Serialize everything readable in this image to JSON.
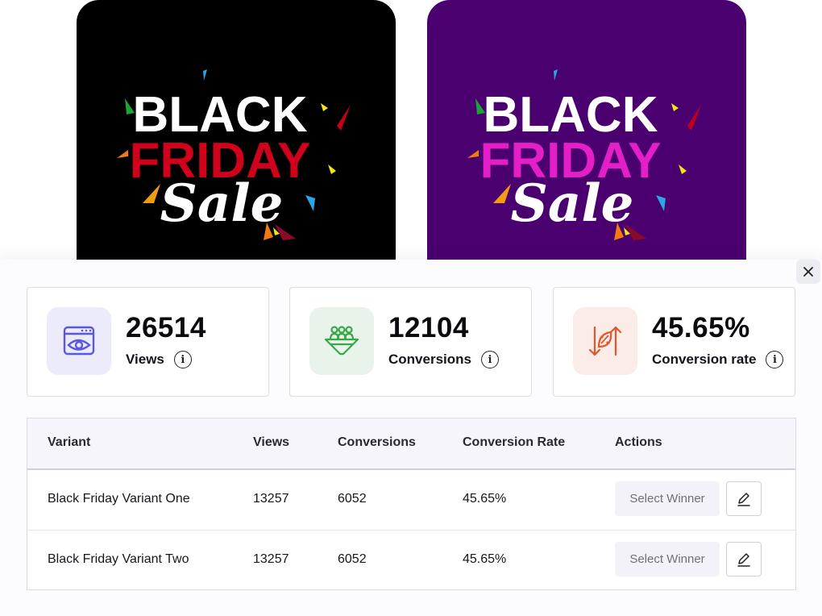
{
  "banners": [
    {
      "line1": "BLACK",
      "line2": "FRIDAY",
      "line3": "Sale",
      "background": "#000000",
      "accent": "#d0021b"
    },
    {
      "line1": "BLACK",
      "line2": "FRIDAY",
      "line3": "Sale",
      "background": "#4a006e",
      "accent": "#e51fc8"
    }
  ],
  "panel": {
    "close_icon": "close-icon",
    "stats": [
      {
        "value": "26514",
        "label": "Views",
        "icon": "view-browser-icon",
        "info": "i",
        "color": "#5b57e0"
      },
      {
        "value": "12104",
        "label": "Conversions",
        "icon": "group-funnel-icon",
        "info": "i",
        "color": "#3aa64a"
      },
      {
        "value": "45.65%",
        "label": "Conversion rate",
        "icon": "conversion-rate-icon",
        "info": "i",
        "color": "#e3562b"
      }
    ],
    "table": {
      "headers": [
        "Variant",
        "Views",
        "Conversions",
        "Conversion Rate",
        "Actions"
      ],
      "rows": [
        {
          "variant": "Black Friday Variant One",
          "views": "13257",
          "conversions": "6052",
          "rate": "45.65%",
          "select_label": "Select Winner",
          "edit_icon": "pencil-icon"
        },
        {
          "variant": "Black Friday Variant Two",
          "views": "13257",
          "conversions": "6052",
          "rate": "45.65%",
          "select_label": "Select Winner",
          "edit_icon": "pencil-icon"
        }
      ]
    }
  }
}
